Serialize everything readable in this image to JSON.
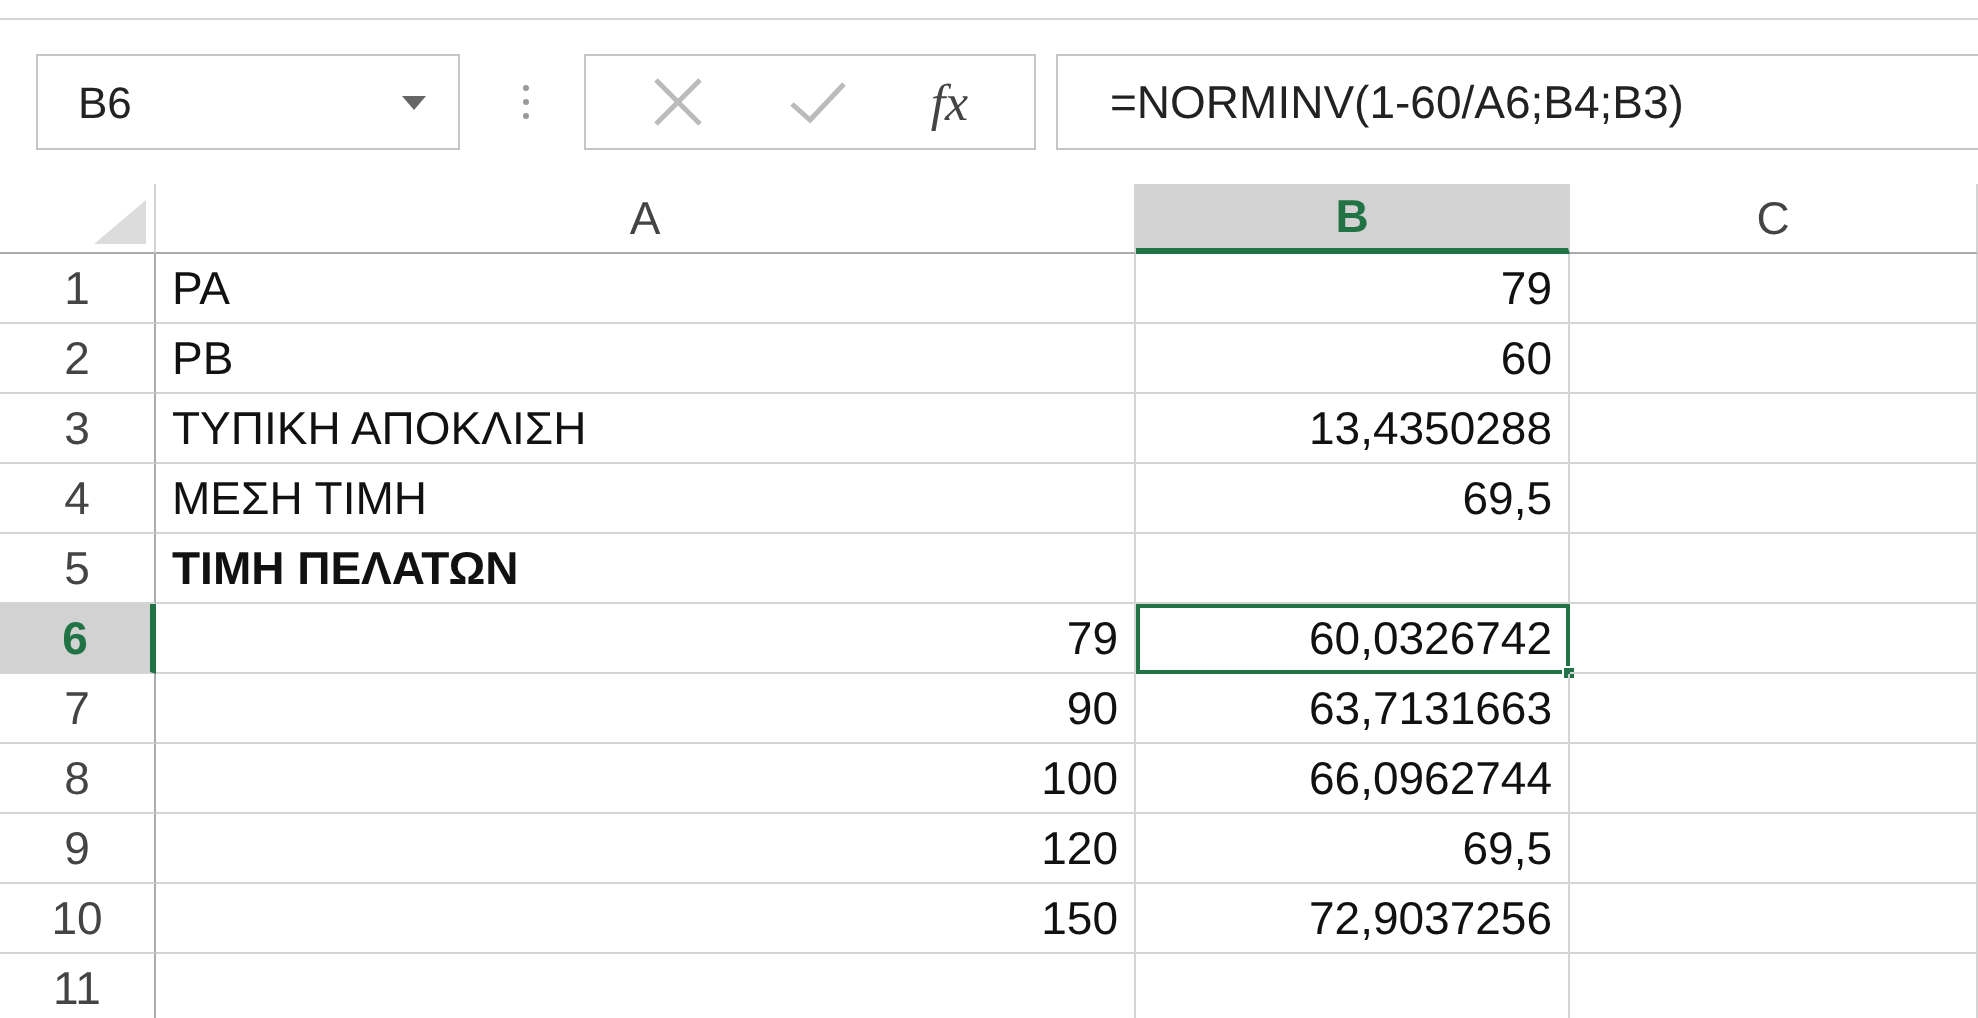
{
  "name_box": {
    "value": "B6"
  },
  "formula_bar": {
    "function_label": "fx",
    "formula": "=NORMINV(1-60/A6;B4;B3)"
  },
  "columns": [
    {
      "label": "A",
      "selected": false
    },
    {
      "label": "B",
      "selected": true
    },
    {
      "label": "C",
      "selected": false
    }
  ],
  "rows": [
    {
      "number": "1",
      "selected": false,
      "cells": [
        {
          "value": "PA",
          "kind": "text",
          "bold": false,
          "selected": false
        },
        {
          "value": "79",
          "kind": "number",
          "selected": false
        },
        {
          "selected": false
        }
      ]
    },
    {
      "number": "2",
      "selected": false,
      "cells": [
        {
          "value": "PB",
          "kind": "text",
          "bold": false,
          "selected": false
        },
        {
          "value": "60",
          "kind": "number",
          "selected": false
        },
        {
          "selected": false
        }
      ]
    },
    {
      "number": "3",
      "selected": false,
      "cells": [
        {
          "value": "ΤΥΠΙΚΗ ΑΠΟΚΛΙΣΗ",
          "kind": "text",
          "bold": false,
          "selected": false
        },
        {
          "value": "13,4350288",
          "kind": "number",
          "selected": false
        },
        {
          "selected": false
        }
      ]
    },
    {
      "number": "4",
      "selected": false,
      "cells": [
        {
          "value": "ΜΕΣΗ ΤΙΜΗ",
          "kind": "text",
          "bold": false,
          "selected": false
        },
        {
          "value": "69,5",
          "kind": "number",
          "selected": false
        },
        {
          "selected": false
        }
      ]
    },
    {
      "number": "5",
      "selected": false,
      "cells": [
        {
          "value": "ΤΙΜΗ ΠΕΛΑΤΩΝ",
          "kind": "text",
          "bold": true,
          "selected": false
        },
        {
          "selected": false
        },
        {
          "selected": false
        }
      ]
    },
    {
      "number": "6",
      "selected": true,
      "cells": [
        {
          "value": "79",
          "kind": "number",
          "selected": false
        },
        {
          "value": "60,0326742",
          "kind": "number",
          "selected": true
        },
        {
          "selected": false
        }
      ]
    },
    {
      "number": "7",
      "selected": false,
      "cells": [
        {
          "value": "90",
          "kind": "number",
          "selected": false
        },
        {
          "value": "63,7131663",
          "kind": "number",
          "selected": false
        },
        {
          "selected": false
        }
      ]
    },
    {
      "number": "8",
      "selected": false,
      "cells": [
        {
          "value": "100",
          "kind": "number",
          "selected": false
        },
        {
          "value": "66,0962744",
          "kind": "number",
          "selected": false
        },
        {
          "selected": false
        }
      ]
    },
    {
      "number": "9",
      "selected": false,
      "cells": [
        {
          "value": "120",
          "kind": "number",
          "selected": false
        },
        {
          "value": "69,5",
          "kind": "number",
          "selected": false
        },
        {
          "selected": false
        }
      ]
    },
    {
      "number": "10",
      "selected": false,
      "cells": [
        {
          "value": "150",
          "kind": "number",
          "selected": false
        },
        {
          "value": "72,9037256",
          "kind": "number",
          "selected": false
        },
        {
          "selected": false
        }
      ]
    },
    {
      "number": "11",
      "selected": false,
      "cells": [
        {
          "selected": false
        },
        {
          "selected": false
        },
        {
          "selected": false
        }
      ]
    }
  ]
}
